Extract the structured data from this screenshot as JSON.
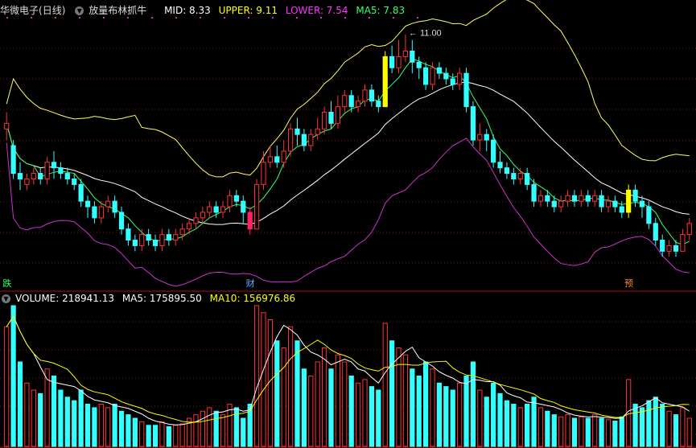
{
  "stock": {
    "name": "华微电子",
    "period": "(日线)",
    "indicator": "放量布林抓牛"
  },
  "indicators": {
    "mid": {
      "label": "MID: 8.33",
      "color": "#ffffff"
    },
    "upper": {
      "label": "UPPER: 9.11",
      "color": "#ffff00"
    },
    "lower": {
      "label": "LOWER: 7.54",
      "color": "#ff33ff"
    },
    "ma5": {
      "label": "MA5: 7.83",
      "color": "#33ff66"
    }
  },
  "price_max_label": "11.00",
  "markers": [
    {
      "text": "跌",
      "index": 0,
      "color": "#33ff66"
    },
    {
      "text": "财",
      "index": 36,
      "color": "#66aaff"
    },
    {
      "text": "预",
      "index": 92,
      "color": "#ff8833"
    }
  ],
  "volume_panel": {
    "volume_label": "VOLUME: 218941.13",
    "ma5_label": "MA5: 175895.50",
    "ma10_label": "MA10: 156976.86",
    "volume_color": "#ffffff",
    "ma5_color": "#ffffff",
    "ma10_color": "#ffff00"
  },
  "colors": {
    "up": "#ff3333",
    "down": "#33ffff",
    "mid": "#ffffff",
    "upper": "#ffff66",
    "lower": "#cc33cc",
    "ma5": "#33ff66",
    "grid": "#7a1010",
    "highlight_up": "#ff2266",
    "highlight_yellow": "#ffff00"
  },
  "chart_data": {
    "type": "candlestick",
    "price_range": [
      7.0,
      11.6
    ],
    "volume_range": [
      0,
      200000
    ],
    "candles": [
      [
        9.6,
        9.7,
        9.9,
        9.4,
        170000
      ],
      [
        9.3,
        8.8,
        9.4,
        8.7,
        200000
      ],
      [
        8.8,
        8.7,
        9.0,
        8.5,
        120000
      ],
      [
        8.6,
        8.7,
        8.8,
        8.5,
        90000
      ],
      [
        8.7,
        8.8,
        8.9,
        8.6,
        80000
      ],
      [
        8.8,
        8.7,
        8.9,
        8.6,
        75000
      ],
      [
        8.7,
        9.0,
        9.1,
        8.6,
        110000
      ],
      [
        9.0,
        8.9,
        9.2,
        8.7,
        100000
      ],
      [
        8.9,
        8.8,
        9.0,
        8.7,
        80000
      ],
      [
        8.8,
        8.7,
        8.9,
        8.6,
        70000
      ],
      [
        8.7,
        8.6,
        8.8,
        8.5,
        65000
      ],
      [
        8.6,
        8.3,
        8.7,
        8.2,
        80000
      ],
      [
        8.3,
        8.2,
        8.4,
        8.0,
        60000
      ],
      [
        8.2,
        8.0,
        8.3,
        7.9,
        55000
      ],
      [
        8.0,
        8.2,
        8.3,
        7.9,
        60000
      ],
      [
        8.2,
        8.3,
        8.4,
        8.1,
        55000
      ],
      [
        8.3,
        8.1,
        8.4,
        8.0,
        60000
      ],
      [
        8.1,
        7.8,
        8.2,
        7.7,
        50000
      ],
      [
        7.8,
        7.6,
        7.9,
        7.5,
        45000
      ],
      [
        7.6,
        7.5,
        7.7,
        7.4,
        40000
      ],
      [
        7.5,
        7.7,
        7.8,
        7.4,
        35000
      ],
      [
        7.7,
        7.6,
        7.8,
        7.5,
        30000
      ],
      [
        7.6,
        7.5,
        7.7,
        7.4,
        30000
      ],
      [
        7.5,
        7.7,
        7.8,
        7.4,
        35000
      ],
      [
        7.7,
        7.6,
        7.8,
        7.5,
        28000
      ],
      [
        7.6,
        7.7,
        7.8,
        7.5,
        30000
      ],
      [
        7.7,
        7.8,
        7.9,
        7.6,
        32000
      ],
      [
        7.8,
        7.9,
        8.0,
        7.7,
        40000
      ],
      [
        7.9,
        8.0,
        8.1,
        7.8,
        45000
      ],
      [
        8.0,
        8.1,
        8.2,
        7.9,
        50000
      ],
      [
        8.1,
        8.2,
        8.3,
        8.0,
        55000
      ],
      [
        8.2,
        8.1,
        8.3,
        8.0,
        50000
      ],
      [
        8.1,
        8.2,
        8.3,
        8.0,
        45000
      ],
      [
        8.2,
        8.4,
        8.5,
        8.1,
        60000
      ],
      [
        8.4,
        8.3,
        8.5,
        8.2,
        55000
      ],
      [
        8.3,
        8.1,
        8.4,
        7.9,
        40000
      ],
      [
        8.1,
        7.8,
        8.2,
        7.7,
        60000
      ],
      [
        7.8,
        8.6,
        8.7,
        7.8,
        200000
      ],
      [
        8.6,
        9.0,
        9.2,
        8.5,
        190000
      ],
      [
        9.0,
        9.1,
        9.3,
        8.9,
        180000
      ],
      [
        9.1,
        9.0,
        9.3,
        8.9,
        150000
      ],
      [
        9.0,
        9.2,
        9.4,
        8.9,
        140000
      ],
      [
        9.2,
        9.6,
        9.7,
        9.1,
        170000
      ],
      [
        9.6,
        9.5,
        9.8,
        9.3,
        150000
      ],
      [
        9.5,
        9.3,
        9.6,
        9.2,
        110000
      ],
      [
        9.3,
        9.5,
        9.6,
        9.2,
        100000
      ],
      [
        9.5,
        9.6,
        9.8,
        9.4,
        120000
      ],
      [
        9.6,
        9.9,
        10.0,
        9.5,
        140000
      ],
      [
        9.9,
        9.7,
        10.1,
        9.6,
        110000
      ],
      [
        9.7,
        10.0,
        10.2,
        9.6,
        130000
      ],
      [
        10.0,
        10.2,
        10.3,
        9.9,
        120000
      ],
      [
        10.2,
        10.0,
        10.3,
        9.9,
        100000
      ],
      [
        10.0,
        10.1,
        10.2,
        9.9,
        90000
      ],
      [
        10.1,
        10.3,
        10.4,
        10.0,
        95000
      ],
      [
        10.3,
        10.1,
        10.4,
        10.0,
        85000
      ],
      [
        10.1,
        10.0,
        10.2,
        9.9,
        80000
      ],
      [
        10.0,
        10.9,
        11.0,
        10.0,
        175000
      ],
      [
        10.9,
        10.7,
        11.1,
        10.6,
        150000
      ],
      [
        10.7,
        10.9,
        11.2,
        10.6,
        140000
      ],
      [
        10.9,
        11.0,
        11.3,
        10.8,
        130000
      ],
      [
        11.0,
        10.8,
        11.2,
        10.6,
        110000
      ],
      [
        10.8,
        10.7,
        10.9,
        10.5,
        100000
      ],
      [
        10.7,
        10.4,
        10.8,
        10.3,
        120000
      ],
      [
        10.4,
        10.7,
        10.8,
        10.3,
        110000
      ],
      [
        10.7,
        10.6,
        10.8,
        10.5,
        90000
      ],
      [
        10.6,
        10.5,
        10.7,
        10.4,
        85000
      ],
      [
        10.5,
        10.4,
        10.6,
        10.3,
        80000
      ],
      [
        10.4,
        10.6,
        10.7,
        10.3,
        90000
      ],
      [
        10.6,
        10.0,
        10.7,
        9.9,
        100000
      ],
      [
        10.0,
        9.4,
        10.1,
        9.3,
        120000
      ],
      [
        9.4,
        9.5,
        9.7,
        9.2,
        80000
      ],
      [
        9.5,
        9.4,
        9.6,
        9.2,
        70000
      ],
      [
        9.4,
        9.0,
        9.5,
        8.9,
        90000
      ],
      [
        9.0,
        8.9,
        9.2,
        8.8,
        75000
      ],
      [
        8.9,
        8.8,
        9.0,
        8.7,
        65000
      ],
      [
        8.8,
        8.7,
        8.9,
        8.6,
        60000
      ],
      [
        8.7,
        8.8,
        8.9,
        8.6,
        55000
      ],
      [
        8.8,
        8.6,
        8.9,
        8.5,
        60000
      ],
      [
        8.6,
        8.3,
        8.7,
        8.2,
        70000
      ],
      [
        8.3,
        8.4,
        8.5,
        8.2,
        55000
      ],
      [
        8.4,
        8.3,
        8.5,
        8.2,
        50000
      ],
      [
        8.3,
        8.2,
        8.4,
        8.1,
        45000
      ],
      [
        8.2,
        8.3,
        8.4,
        8.1,
        42000
      ],
      [
        8.3,
        8.4,
        8.5,
        8.2,
        45000
      ],
      [
        8.4,
        8.3,
        8.5,
        8.2,
        40000
      ],
      [
        8.3,
        8.4,
        8.5,
        8.2,
        42000
      ],
      [
        8.4,
        8.3,
        8.5,
        8.2,
        40000
      ],
      [
        8.3,
        8.4,
        8.5,
        8.2,
        45000
      ],
      [
        8.4,
        8.2,
        8.5,
        8.1,
        40000
      ],
      [
        8.2,
        8.3,
        8.4,
        8.1,
        38000
      ],
      [
        8.3,
        8.2,
        8.4,
        8.1,
        36000
      ],
      [
        8.2,
        8.1,
        8.3,
        8.0,
        42000
      ],
      [
        8.1,
        8.5,
        8.6,
        8.0,
        95000
      ],
      [
        8.5,
        8.3,
        8.6,
        8.2,
        60000
      ],
      [
        8.3,
        8.2,
        8.4,
        8.0,
        55000
      ],
      [
        8.2,
        7.9,
        8.3,
        7.8,
        65000
      ],
      [
        7.9,
        7.6,
        8.0,
        7.5,
        70000
      ],
      [
        7.6,
        7.4,
        7.7,
        7.3,
        60000
      ],
      [
        7.4,
        7.5,
        7.6,
        7.3,
        50000
      ],
      [
        7.5,
        7.4,
        7.6,
        7.3,
        45000
      ],
      [
        7.4,
        7.7,
        7.8,
        7.4,
        55000
      ],
      [
        7.7,
        7.9,
        8.0,
        7.6,
        40000
      ]
    ],
    "highlight_indices": {
      "pink": 36,
      "yellow": [
        56,
        92
      ]
    }
  }
}
